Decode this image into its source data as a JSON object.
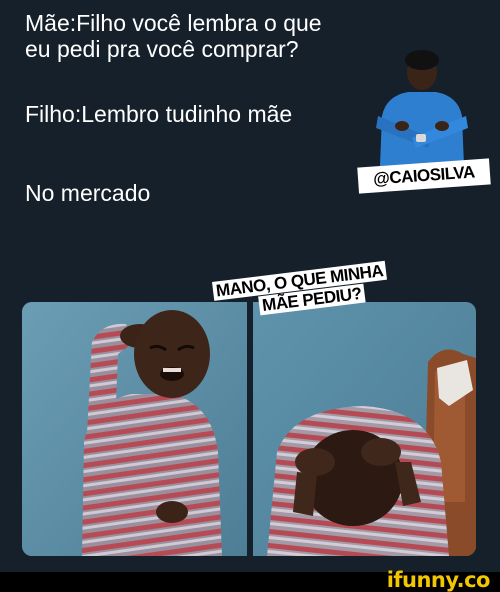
{
  "tweet": {
    "line1": "Mãe:Filho você lembra o que",
    "line2": "eu pedi pra você comprar?",
    "line3": "Filho:Lembro tudinho mãe",
    "line4": "No mercado"
  },
  "watermark_handle": "@CAIOSILVA",
  "caption": {
    "line1": "MANO, O QUE MINHA",
    "line2": "MÃE PEDIU?"
  },
  "footer": {
    "logo": "ifunny.co"
  },
  "colors": {
    "background": "#15202b",
    "text": "#ffffff",
    "logo": "#f2c700"
  }
}
